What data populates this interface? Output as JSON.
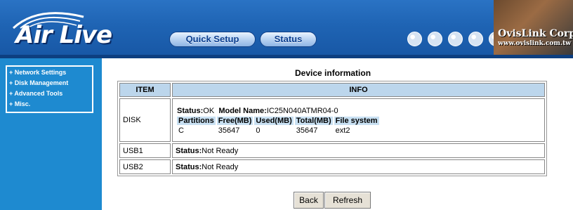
{
  "header": {
    "logo_text": "Air Live",
    "nav": {
      "quick_setup": "Quick Setup",
      "status": "Status"
    },
    "company": "OvisLink Corp.",
    "company_url": "www.ovislink.com.tw"
  },
  "sidebar": {
    "items": [
      {
        "label": "+ Network Settings"
      },
      {
        "label": "+ Disk Management"
      },
      {
        "label": "+ Advanced Tools"
      },
      {
        "label": "+ Misc."
      }
    ]
  },
  "content": {
    "title": "Device information",
    "headers": {
      "item": "ITEM",
      "info": "INFO"
    },
    "disk": {
      "item": "DISK",
      "status_label": "Status:",
      "status_value": "OK",
      "model_label": "Model Name:",
      "model_value": "IC25N040ATMR04-0",
      "columns": [
        "Partitions",
        "Free(MB)",
        "Used(MB)",
        "Total(MB)",
        "File system"
      ],
      "row": [
        "C",
        "35647",
        "0",
        "35647",
        "ext2"
      ]
    },
    "usb1": {
      "item": "USB1",
      "status_label": "Status:",
      "status_value": "Not Ready"
    },
    "usb2": {
      "item": "USB2",
      "status_label": "Status:",
      "status_value": "Not Ready"
    }
  },
  "buttons": {
    "back": "Back",
    "refresh": "Refresh"
  },
  "colors": {
    "header_blue": "#1f64b4",
    "sidebar_blue": "#1e8ad0",
    "table_header": "#bcd6ec"
  }
}
